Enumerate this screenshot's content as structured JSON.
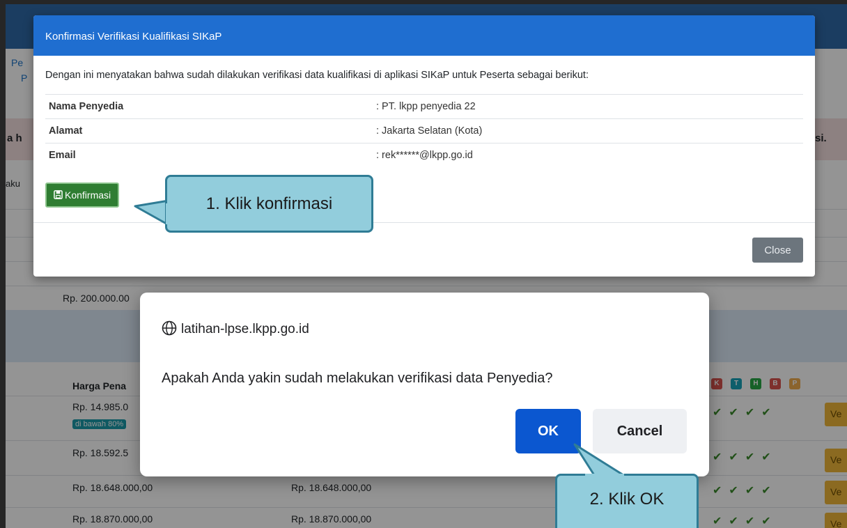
{
  "modal": {
    "title": "Konfirmasi Verifikasi Kualifikasi SIKaP",
    "intro": "Dengan ini menyatakan bahwa sudah dilakukan verifikasi data kualifikasi di aplikasi SIKaP untuk Peserta sebagai berikut:",
    "rows": [
      {
        "label": "Nama Penyedia",
        "value": ": PT. lkpp penyedia 22"
      },
      {
        "label": "Alamat",
        "value": ": Jakarta Selatan (Kota)"
      },
      {
        "label": "Email",
        "value": ": rek******@lkpp.go.id"
      }
    ],
    "confirm_label": "Konfirmasi",
    "close_label": "Close"
  },
  "callouts": {
    "step1": "1. Klik konfirmasi",
    "step2": "2. Klik OK"
  },
  "dialog": {
    "origin": "latihan-lpse.lkpp.go.id",
    "message": "Apakah Anda yakin sudah melakukan verifikasi data Penyedia?",
    "ok_label": "OK",
    "cancel_label": "Cancel"
  },
  "background": {
    "left_link_1": "Pe",
    "left_link_2": "P",
    "left_fragment": "a h",
    "right_fragment": "si.",
    "left_fragment_2": "aku",
    "price_partial": "Rp. 200.000.00",
    "price_column_header": "Harga Pena",
    "rows": [
      {
        "col1": "Rp. 14.985.0",
        "col2": ""
      },
      {
        "col1": "Rp. 18.592.5",
        "col2": ""
      },
      {
        "col1": "Rp. 18.648.000,00",
        "col2": "Rp. 18.648.000,00"
      },
      {
        "col1": "Rp. 18.870.000,00",
        "col2": "Rp. 18.870.000,00"
      }
    ],
    "below_80_badge": "di bawah 80%",
    "status_badges": [
      "K",
      "T",
      "H",
      "B",
      "P"
    ],
    "badge_colors": [
      "#d9534f",
      "#17a2b8",
      "#28a745",
      "#d9534f",
      "#f0ad4e"
    ],
    "yellow_button": "Ve"
  },
  "colors": {
    "modal_header": "#1f6ed0",
    "confirm_button": "#2f7d32",
    "ok_button": "#0b57d0",
    "callout_fill": "#92cddc",
    "callout_border": "#2f7c95"
  }
}
